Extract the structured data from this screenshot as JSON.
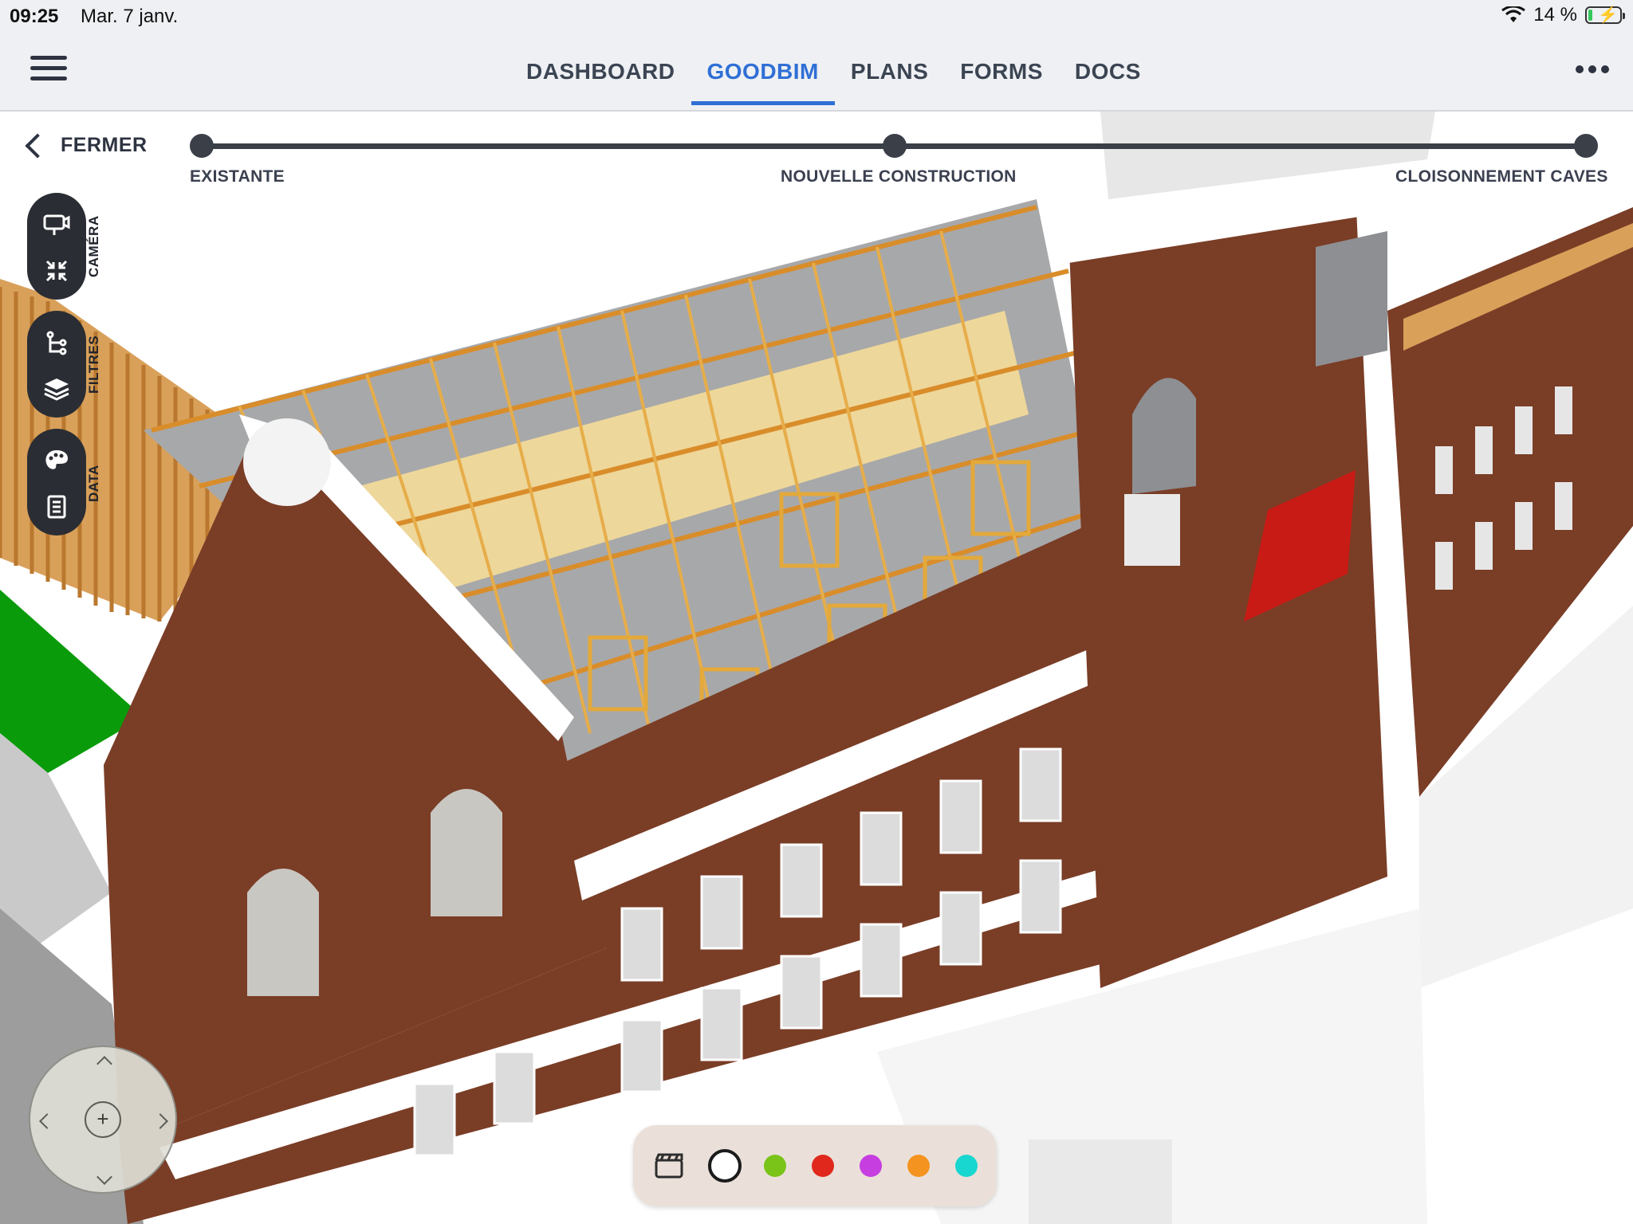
{
  "status_bar": {
    "time": "09:25",
    "date": "Mar. 7 janv.",
    "battery": "14 %",
    "battery_level": 0.14
  },
  "nav": {
    "tabs": [
      {
        "label": "DASHBOARD",
        "active": false
      },
      {
        "label": "GOODBIM",
        "active": true
      },
      {
        "label": "PLANS",
        "active": false
      },
      {
        "label": "FORMS",
        "active": false
      },
      {
        "label": "DOCS",
        "active": false
      }
    ],
    "menu_icon": "hamburger-icon",
    "more_icon": "more-dots-icon"
  },
  "close": {
    "label": "FERMER",
    "icon": "chevron-left-icon"
  },
  "timeline": {
    "phases": [
      "EXISTANTE",
      "NOUVELLE CONSTRUCTION",
      "CLOISONNEMENT CAVES"
    ]
  },
  "side_tools": {
    "camera": {
      "label": "CAMÉRA",
      "icons": [
        "camera-icon",
        "collapse-icon"
      ]
    },
    "filters": {
      "label": "FILTRES",
      "icons": [
        "tree-filter-icon",
        "layers-icon"
      ]
    },
    "data": {
      "label": "DATA",
      "icons": [
        "palette-icon",
        "document-icon"
      ]
    }
  },
  "palette": {
    "tool_icon": "clapperboard-icon",
    "selected": "#ffffff",
    "colors": [
      "#7ac41a",
      "#e0281c",
      "#c63ee0",
      "#f59320",
      "#18d6d0"
    ]
  },
  "joystick": {
    "center_symbol": "+"
  },
  "theme": {
    "accent": "#2f6fd6",
    "brick": "#7a3d26",
    "timber": "#e3a93b",
    "highlight": "#e41010"
  }
}
